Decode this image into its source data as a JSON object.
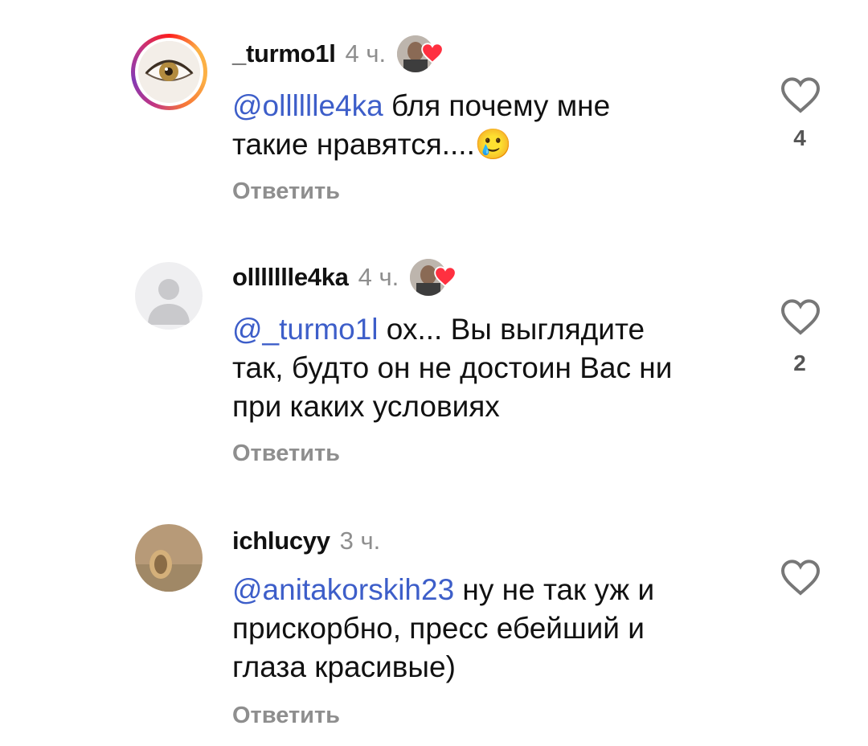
{
  "comments": [
    {
      "username": "_turmo1l",
      "time": "4 ч.",
      "mention": "@olllllle4ka",
      "text_line1": " бля почему мне",
      "text_line2": "такие нравятся....",
      "emoji": "🥲",
      "likes": "4",
      "reply_label": "Ответить"
    },
    {
      "username": "ollllllle4ka",
      "time": "4 ч.",
      "mention": "@_turmo1l",
      "text_line1": " ох... Вы выглядите",
      "text_line2": "так, будто он не достоин Вас ни",
      "text_line3": "при каких условиях",
      "likes": "2",
      "reply_label": "Ответить"
    },
    {
      "username": "ichlucyy",
      "time": "3 ч.",
      "mention": "@anitakorskih23",
      "text_line1": " ну не так уж и",
      "text_line2": "прискорбно, пресс ебейший и",
      "text_line3": "глаза красивые)",
      "reply_label": "Ответить"
    }
  ],
  "colors": {
    "mention": "#3d5ec9",
    "heart": "#ff3040",
    "muted": "#8e8e8e"
  }
}
